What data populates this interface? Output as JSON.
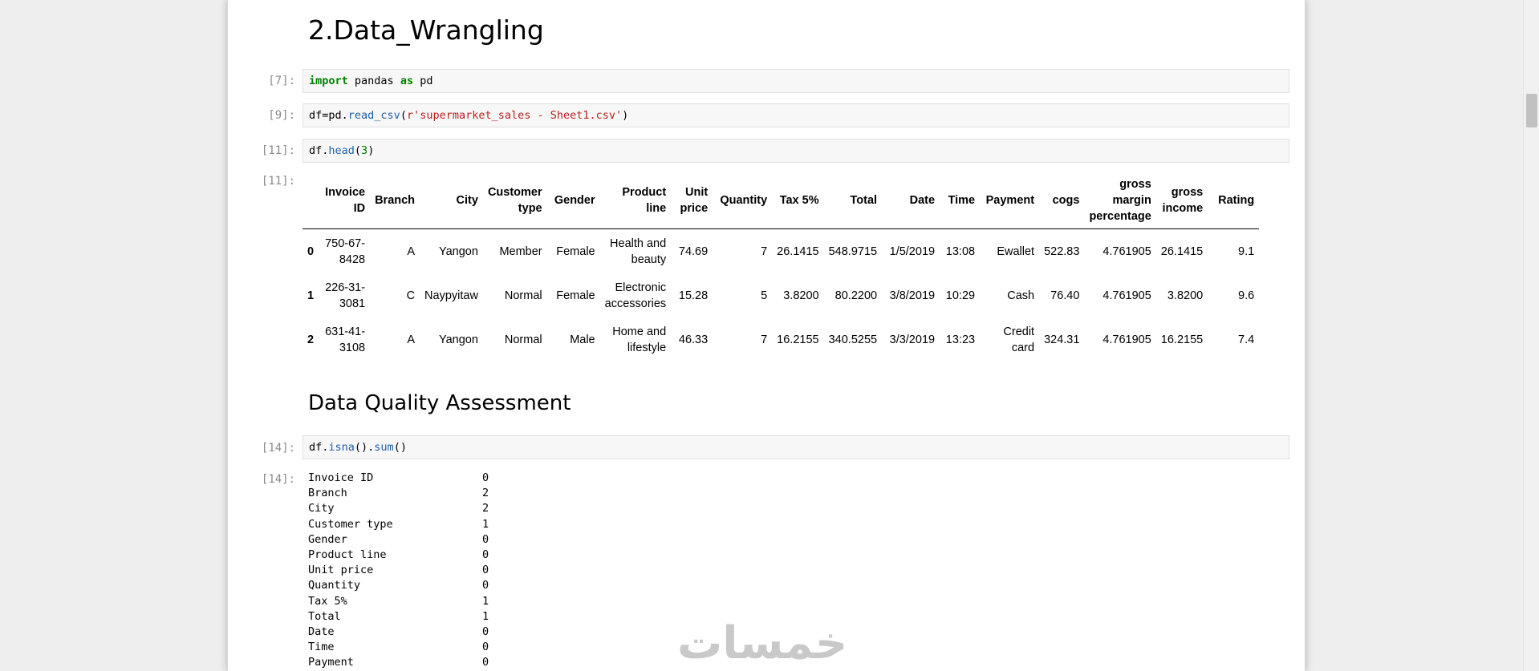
{
  "headings": {
    "data_wrangling": "2.Data_Wrangling",
    "data_quality": "Data Quality Assessment"
  },
  "cells": [
    {
      "prompt": "[7]:",
      "code": {
        "kw1": "import",
        "mod": " pandas ",
        "kw2": "as",
        "alias": " pd"
      }
    },
    {
      "prompt": "[9]:",
      "code": {
        "pre": "df=pd.",
        "fn": "read_csv",
        "open": "(",
        "str": "r'supermarket_sales - Sheet1.csv'",
        "close": ")"
      }
    },
    {
      "prompt": "[11]:",
      "code": {
        "pre": "df.",
        "fn": "head",
        "open": "(",
        "num": "3",
        "close": ")"
      }
    },
    {
      "prompt": "[14]:",
      "code": {
        "pre": "df.",
        "fn1": "isna",
        "mid": "().",
        "fn2": "sum",
        "close": "()"
      }
    }
  ],
  "outputs": {
    "head_prompt": "[11]:",
    "sum_prompt": "[14]:"
  },
  "table": {
    "columns": [
      "Invoice ID",
      "Branch",
      "City",
      "Customer type",
      "Gender",
      "Product line",
      "Unit price",
      "Quantity",
      "Tax 5%",
      "Total",
      "Date",
      "Time",
      "Payment",
      "cogs",
      "gross margin percentage",
      "gross income",
      "Rating"
    ],
    "rows": [
      {
        "index": "0",
        "cells": [
          "750-67-8428",
          "A",
          "Yangon",
          "Member",
          "Female",
          "Health and beauty",
          "74.69",
          "7",
          "26.1415",
          "548.9715",
          "1/5/2019",
          "13:08",
          "Ewallet",
          "522.83",
          "4.761905",
          "26.1415",
          "9.1"
        ]
      },
      {
        "index": "1",
        "cells": [
          "226-31-3081",
          "C",
          "Naypyitaw",
          "Normal",
          "Female",
          "Electronic accessories",
          "15.28",
          "5",
          "3.8200",
          "80.2200",
          "3/8/2019",
          "10:29",
          "Cash",
          "76.40",
          "4.761905",
          "3.8200",
          "9.6"
        ]
      },
      {
        "index": "2",
        "cells": [
          "631-41-3108",
          "A",
          "Yangon",
          "Normal",
          "Male",
          "Home and lifestyle",
          "46.33",
          "7",
          "16.2155",
          "340.5255",
          "3/3/2019",
          "13:23",
          "Credit card",
          "324.31",
          "4.761905",
          "16.2155",
          "7.4"
        ]
      }
    ]
  },
  "isna_sum": [
    {
      "key": "Invoice ID",
      "val": "0"
    },
    {
      "key": "Branch",
      "val": "2"
    },
    {
      "key": "City",
      "val": "2"
    },
    {
      "key": "Customer type",
      "val": "1"
    },
    {
      "key": "Gender",
      "val": "0"
    },
    {
      "key": "Product line",
      "val": "0"
    },
    {
      "key": "Unit price",
      "val": "0"
    },
    {
      "key": "Quantity",
      "val": "0"
    },
    {
      "key": "Tax 5%",
      "val": "1"
    },
    {
      "key": "Total",
      "val": "1"
    },
    {
      "key": "Date",
      "val": "0"
    },
    {
      "key": "Time",
      "val": "0"
    },
    {
      "key": "Payment",
      "val": "0"
    }
  ],
  "watermark": "خمسات",
  "colors": {
    "keyword": "#008000",
    "function": "#1f5fa8",
    "string": "#ba2121",
    "prompt": "#8a8a8a",
    "code_bg": "#f7f7f7"
  }
}
